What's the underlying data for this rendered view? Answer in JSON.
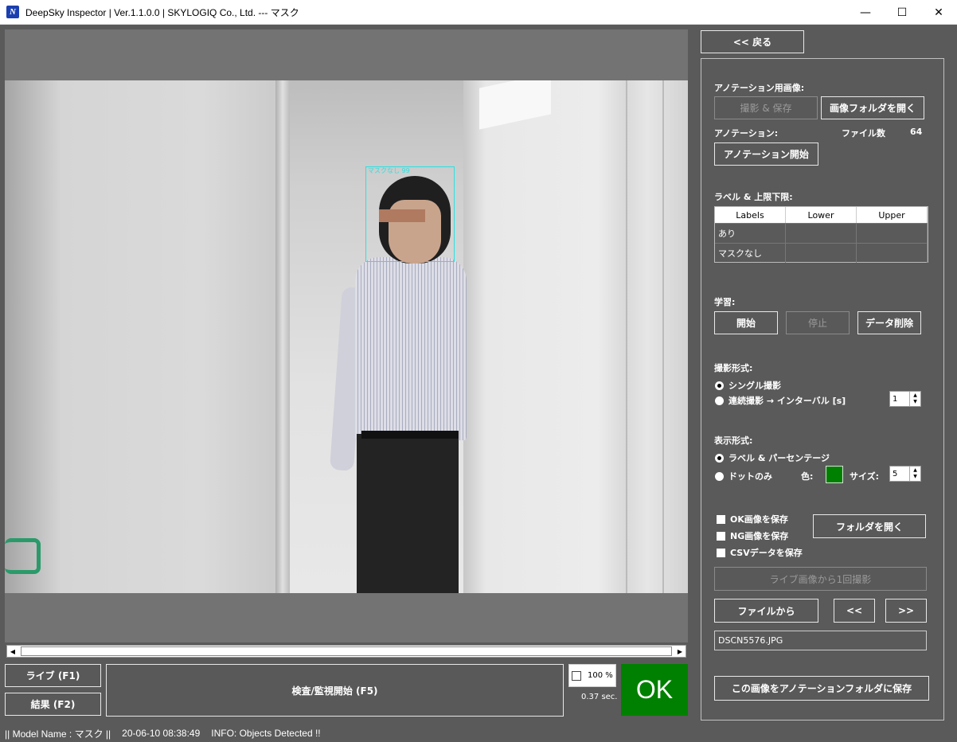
{
  "window": {
    "title": "DeepSky Inspector | Ver.1.1.0.0 | SKYLOGIQ Co., Ltd. --- マスク",
    "icon_letter": "N",
    "minimize": "—",
    "maximize": "☐",
    "close": "✕"
  },
  "viewer": {
    "detection_label": "マスクなし 99"
  },
  "scrollbar": {
    "left_arrow": "◀",
    "right_arrow": "▶"
  },
  "bottom": {
    "live_button": "ライブ (F1)",
    "result_button": "結果 (F2)",
    "inspect_button": "検査/監視開始 (F5)",
    "scale_value": "100 %",
    "elapsed": "0.37 sec.",
    "verdict": "OK"
  },
  "status": {
    "model": "|| Model Name : マスク ||",
    "timestamp": "20-06-10 08:38:49",
    "info": "INFO:   Objects Detected !!"
  },
  "panel": {
    "back_button": "<< 戻る",
    "annotation_image_section": "アノテーション用画像:",
    "capture_save_button": "撮影 & 保存",
    "open_image_folder_button": "画像フォルダを開く",
    "annotation_section": "アノテーション:",
    "file_count_label": "ファイル数",
    "file_count_value": "64",
    "start_annotation_button": "アノテーション開始",
    "labels_section": "ラベル & 上限下限:",
    "table": {
      "headers": [
        "Labels",
        "Lower",
        "Upper"
      ],
      "rows": [
        [
          "あり",
          "",
          ""
        ],
        [
          "マスクなし",
          "",
          ""
        ]
      ]
    },
    "training_section": "学習:",
    "train_start_button": "開始",
    "train_stop_button": "停止",
    "delete_data_button": "データ削除",
    "capture_mode_section": "撮影形式:",
    "single_capture": "シングル撮影",
    "continuous_capture": "連続撮影 → インターバル [s]",
    "interval_value": "1",
    "display_mode_section": "表示形式:",
    "label_percentage": "ラベル & パーセンテージ",
    "dots_only": "ドットのみ",
    "color_label": "色:",
    "dot_color": "#008000",
    "size_label": "サイズ:",
    "size_value": "5",
    "save_ok_images": "OK画像を保存",
    "save_ng_images": "NG画像を保存",
    "save_csv": "CSVデータを保存",
    "open_folder_button": "フォルダを開く",
    "capture_once_button": "ライブ画像から1回撮影",
    "from_file_button": "ファイルから",
    "prev_button": "<<",
    "next_button": ">>",
    "filename": "DSCN5576.JPG",
    "save_to_annotation_button": "この画像をアノテーションフォルダに保存"
  }
}
